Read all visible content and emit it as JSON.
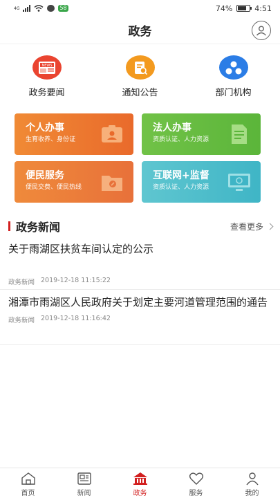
{
  "status_bar": {
    "signal_label": "4G",
    "badge": "58",
    "battery": "74%",
    "battery_level": 0.74,
    "time": "4:51"
  },
  "header": {
    "title": "政务"
  },
  "shortcuts": [
    {
      "label": "政务要闻",
      "icon": "news-icon",
      "color": "#ea4430",
      "icon_text": "NEWS"
    },
    {
      "label": "通知公告",
      "icon": "notice-icon",
      "color": "#f39a1f"
    },
    {
      "label": "部门机构",
      "icon": "department-icon",
      "color": "#2b7de6"
    }
  ],
  "cards": [
    {
      "title": "个人办事",
      "desc": "生育收养、身份证",
      "icon": "id-card-icon",
      "color": "#ec7b30"
    },
    {
      "title": "法人办事",
      "desc": "资质认证、人力资源",
      "icon": "document-icon",
      "color": "#66bc40"
    },
    {
      "title": "便民服务",
      "desc": "便民交费、便民热线",
      "icon": "folder-icon",
      "color": "#eb7f38"
    },
    {
      "title": "互联网+监督",
      "desc": "资质认证、人力资源",
      "icon": "monitor-icon",
      "color": "#4ebdca"
    }
  ],
  "news_section": {
    "title": "政务新闻",
    "more_label": "查看更多"
  },
  "news": [
    {
      "title": "关于雨湖区扶贫车间认定的公示",
      "category": "政务新闻",
      "time": "2019-12-18 11:15:22"
    },
    {
      "title": "湘潭市雨湖区人民政府关于划定主要河道管理范围的通告",
      "category": "政务新闻",
      "time": "2019-12-18 11:16:42"
    }
  ],
  "tabs": [
    {
      "label": "首页",
      "icon": "home-icon",
      "active": false
    },
    {
      "label": "新闻",
      "icon": "newspaper-icon",
      "active": false
    },
    {
      "label": "政务",
      "icon": "government-icon",
      "active": true
    },
    {
      "label": "服务",
      "icon": "heart-icon",
      "active": false
    },
    {
      "label": "我的",
      "icon": "person-icon",
      "active": false
    }
  ],
  "colors": {
    "accent": "#d21f1f"
  }
}
